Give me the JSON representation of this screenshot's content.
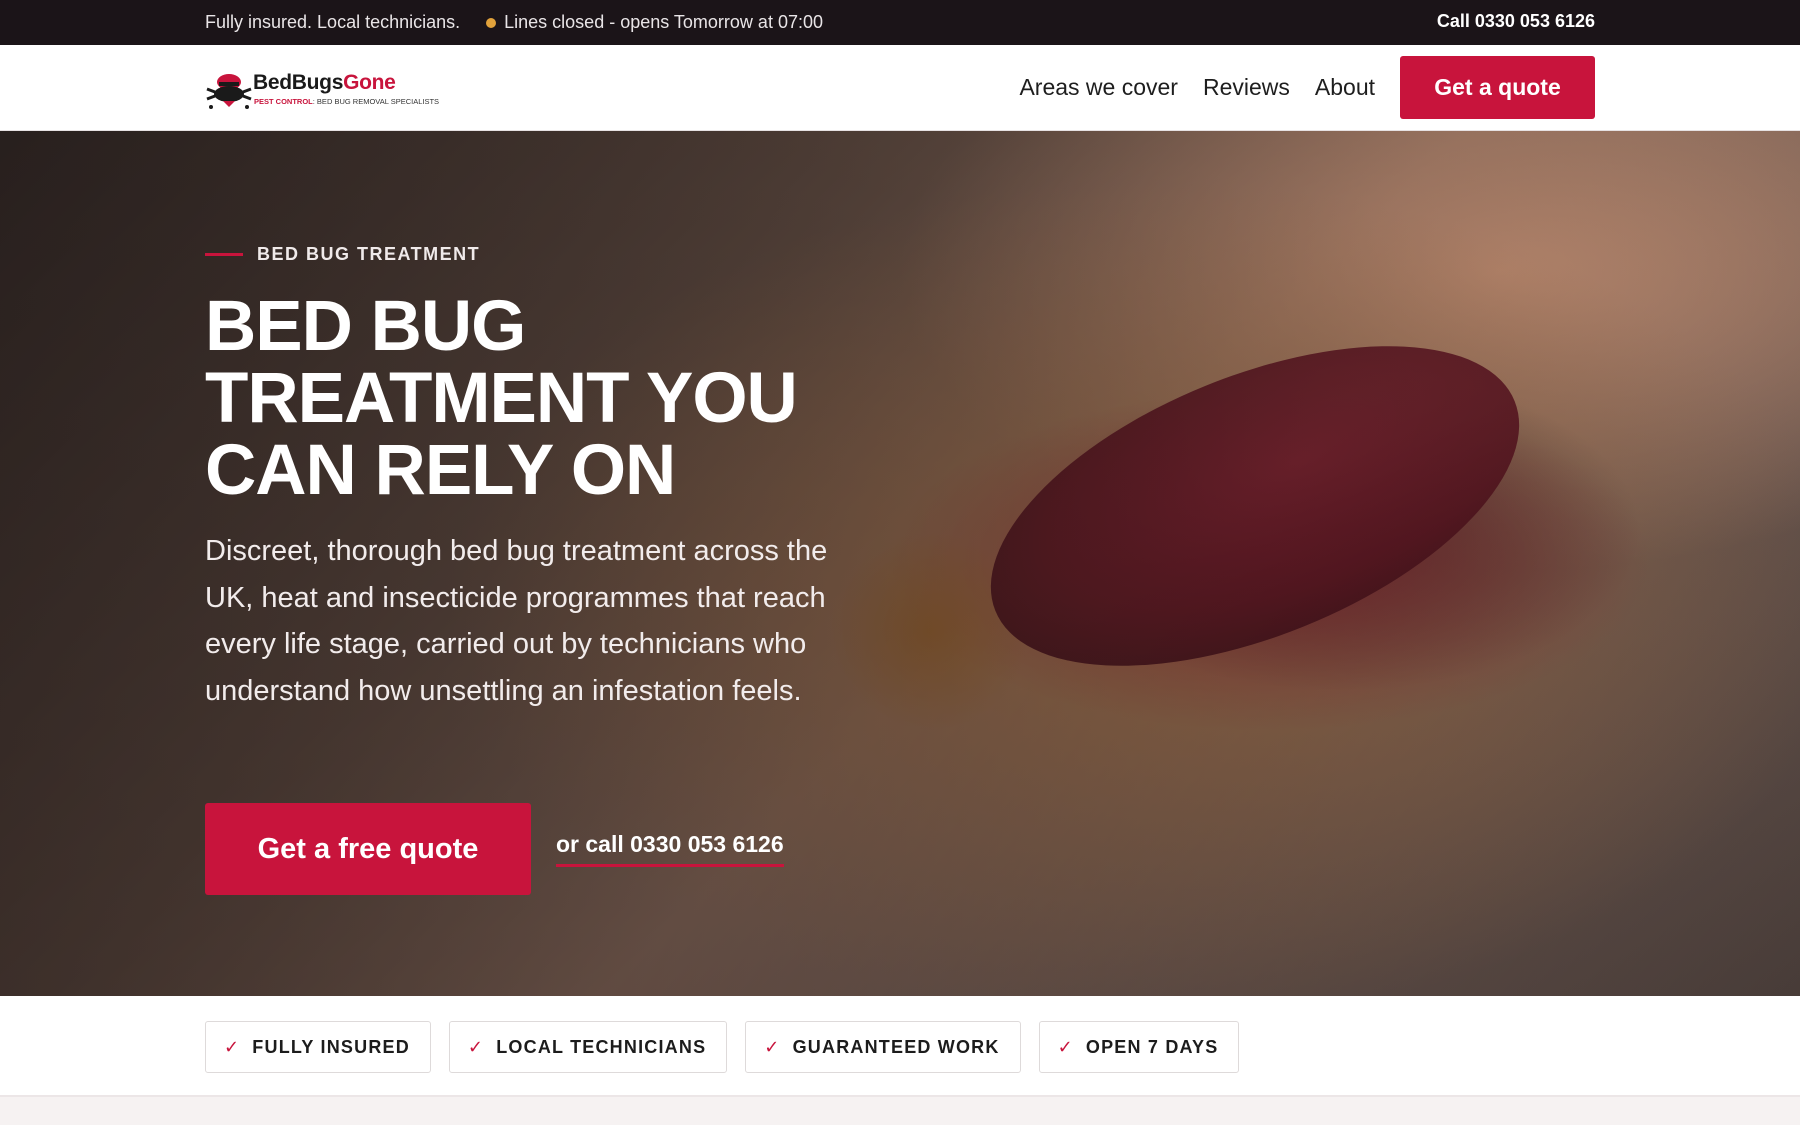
{
  "topbar": {
    "tagline": "Fully insured. Local technicians.",
    "status": "Lines closed - opens Tomorrow at 07:00",
    "call": "Call 0330 053 6126",
    "status_color": "#e2a23b"
  },
  "nav": {
    "logo_name_part1": "BedBugs",
    "logo_name_part2": "Gone",
    "logo_tag_part1": "PEST CONTROL",
    "logo_tag_part2": ": BED BUG REMOVAL SPECIALISTS",
    "links": [
      "Areas we cover",
      "Reviews",
      "About"
    ],
    "cta": "Get a quote"
  },
  "hero": {
    "eyebrow": "BED BUG TREATMENT",
    "headline": "BED BUG TREATMENT YOU CAN RELY ON",
    "lead": "Discreet, thorough bed bug treatment across the UK, heat and insecticide programmes that reach every life stage, carried out by technicians who understand how unsettling an infestation feels.",
    "cta": "Get a free quote",
    "call": "or call 0330 053 6126"
  },
  "trust": {
    "badges": [
      "FULLY INSURED",
      "LOCAL TECHNICIANS",
      "GUARANTEED WORK",
      "OPEN 7 DAYS"
    ]
  },
  "colors": {
    "accent": "#c8143c",
    "topbar_bg": "#1b1418"
  },
  "icons": {
    "badge_check": "check-icon",
    "logo": "bedbug-logo-icon"
  }
}
